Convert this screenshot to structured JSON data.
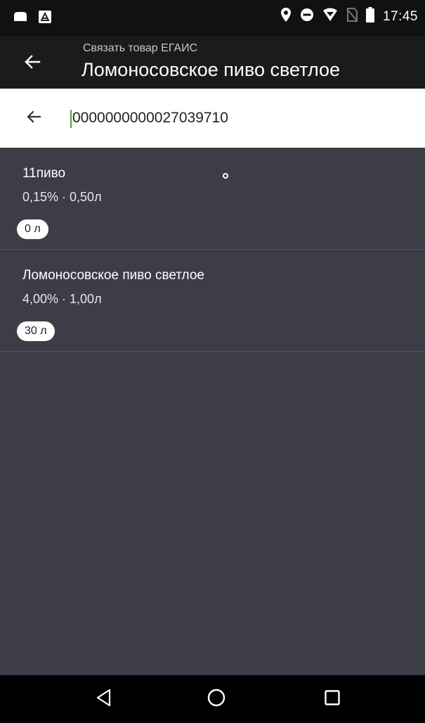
{
  "status_bar": {
    "time": "17:45",
    "icons": [
      "notification-icon",
      "photo-icon",
      "location-icon",
      "do-not-disturb-icon",
      "signal-icon",
      "no-sim-icon",
      "battery-icon"
    ]
  },
  "app_bar": {
    "subtitle": "Связать товар ЕГАИС",
    "title": "Ломоносовское пиво светлое",
    "back_icon": "arrow-back-icon"
  },
  "search": {
    "value": "0000000000027039710",
    "back_icon": "arrow-back-icon"
  },
  "items": [
    {
      "name": "11пиво",
      "details": "0,15% · 0,50л",
      "badge": "0 л"
    },
    {
      "name": "Ломоносовское пиво светлое",
      "details": "4,00% · 1,00л",
      "badge": "30 л"
    }
  ],
  "nav_bar": {
    "buttons": [
      "back-triangle-icon",
      "home-circle-icon",
      "recents-square-icon"
    ]
  },
  "colors": {
    "background": "#3c3d47",
    "app_bar": "#1b1b1b",
    "status_bar": "#111111",
    "cursor": "#5aa02c"
  }
}
